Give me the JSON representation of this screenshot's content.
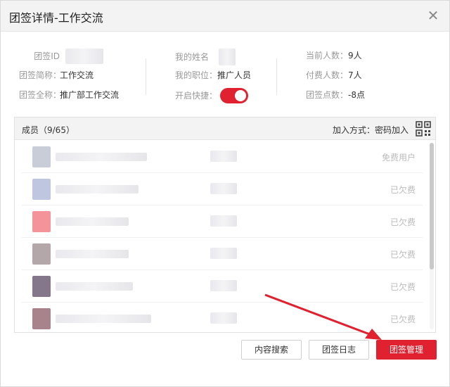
{
  "window": {
    "title": "团签详情-工作交流",
    "close_icon": "close-icon"
  },
  "info": {
    "col1": [
      {
        "label": "团签ID",
        "value": ""
      },
      {
        "label": "团签简称：",
        "value": "工作交流"
      },
      {
        "label": "团签全称：",
        "value": "推广部工作交流"
      }
    ],
    "col2": [
      {
        "label": "我的姓名",
        "value": ""
      },
      {
        "label": "我的职位：",
        "value": "推广人员"
      },
      {
        "label": "开启快捷：",
        "value": ""
      }
    ],
    "col3": [
      {
        "label": "当前人数：",
        "value": "9人"
      },
      {
        "label": "付费人数：",
        "value": "7人"
      },
      {
        "label": "团签点数：",
        "value": "-8点"
      }
    ],
    "shortcut_enabled": true,
    "accent_color": "#e0212f"
  },
  "members": {
    "title": "成员（9/65）",
    "join_method": "加入方式：密码加入",
    "qr_icon": "qr-code-icon",
    "rows": [
      {
        "status": "免费用户",
        "avatar_color": "#b7bcc9"
      },
      {
        "status": "已欠费",
        "avatar_color": "#a9b3d6"
      },
      {
        "status": "已欠费",
        "avatar_color": "#f07078"
      },
      {
        "status": "已欠费",
        "avatar_color": "#9a8a8e"
      },
      {
        "status": "已欠费",
        "avatar_color": "#5b4a66"
      },
      {
        "status": "已欠费",
        "avatar_color": "#8c5a64"
      }
    ]
  },
  "buttons": {
    "search": "内容搜索",
    "log": "团签日志",
    "manage": "团签管理"
  }
}
